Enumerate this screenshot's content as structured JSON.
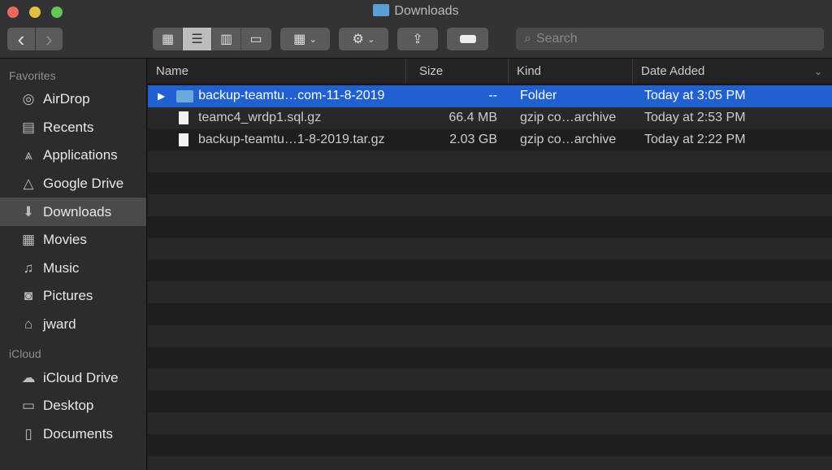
{
  "window": {
    "title": "Downloads",
    "colors": {
      "close": "#ed6a5e",
      "minimize": "#e0bf44",
      "zoom": "#62c554",
      "selection": "#2160d0"
    }
  },
  "toolbar": {
    "back": "‹",
    "forward": "›",
    "view_icons": [
      "icon-view-icon",
      "list-view-icon",
      "column-view-icon",
      "gallery-view-icon"
    ],
    "group_icon": "group-icon",
    "action_icon": "gear-icon",
    "share_icon": "share-icon",
    "tag_icon": "tag-icon",
    "search_placeholder": "Search"
  },
  "sidebar": {
    "favorites_header": "Favorites",
    "favorites": [
      {
        "label": "AirDrop",
        "icon": "◎"
      },
      {
        "label": "Recents",
        "icon": "▤"
      },
      {
        "label": "Applications",
        "icon": "⩓"
      },
      {
        "label": "Google Drive",
        "icon": "△"
      },
      {
        "label": "Downloads",
        "icon": "⬇",
        "selected": true
      },
      {
        "label": "Movies",
        "icon": "▦"
      },
      {
        "label": "Music",
        "icon": "♫"
      },
      {
        "label": "Pictures",
        "icon": "◙"
      },
      {
        "label": "jward",
        "icon": "⌂"
      }
    ],
    "icloud_header": "iCloud",
    "icloud": [
      {
        "label": "iCloud Drive",
        "icon": "☁"
      },
      {
        "label": "Desktop",
        "icon": "▭"
      },
      {
        "label": "Documents",
        "icon": "▯"
      }
    ]
  },
  "columns": {
    "name": "Name",
    "size": "Size",
    "kind": "Kind",
    "date": "Date Added"
  },
  "files": [
    {
      "name": "backup-teamtu…com-11-8-2019",
      "size": "--",
      "kind": "Folder",
      "date": "Today at 3:05 PM",
      "type": "folder",
      "selected": true
    },
    {
      "name": "teamc4_wrdp1.sql.gz",
      "size": "66.4 MB",
      "kind": "gzip co…archive",
      "date": "Today at 2:53 PM",
      "type": "file"
    },
    {
      "name": "backup-teamtu…1-8-2019.tar.gz",
      "size": "2.03 GB",
      "kind": "gzip co…archive",
      "date": "Today at 2:22 PM",
      "type": "file"
    }
  ]
}
